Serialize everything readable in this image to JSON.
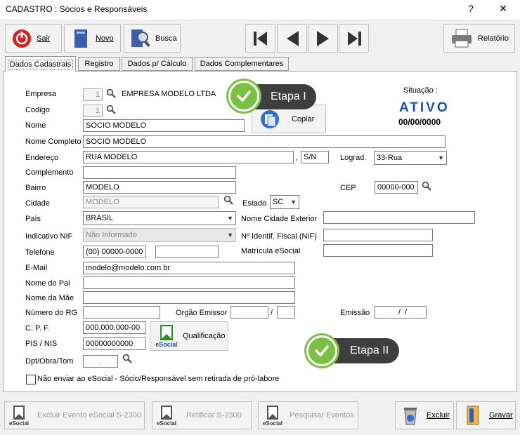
{
  "window": {
    "title": "CADASTRO : Sócios e Responsáveis",
    "help": "?",
    "close": "✕"
  },
  "toolbar": {
    "exit": "Sair",
    "new": "Novo",
    "search": "Busca",
    "report": "Relatório"
  },
  "tabs": [
    "Dados Cadastrais",
    "Registro",
    "Dados p/ Cálculo",
    "Dados Complementares"
  ],
  "form": {
    "empresa_label": "Empresa",
    "empresa_code": "1",
    "empresa_name": "EMPRESA MODELO LTDA",
    "codigo_label": "Codigo",
    "codigo_value": "1",
    "nome_label": "Nome",
    "nome_value": "SOCIO MODELO",
    "copiar": "Copiar",
    "nome_completo_label": "Nome Completo",
    "nome_completo_value": "SOCIO MODELO",
    "endereco_label": "Endereço",
    "endereco_value": "RUA MODELO",
    "numero_sep": ",",
    "numero_value": "S/N",
    "lograd_label": "Lograd.",
    "lograd_value": "33-Rua",
    "complemento_label": "Complemento",
    "complemento_value": "",
    "bairro_label": "Bairro",
    "bairro_value": "MODELO",
    "cep_label": "CEP",
    "cep_value": "00000-000",
    "cidade_label": "Cidade",
    "cidade_value": "MODELO",
    "estado_label": "Estado",
    "estado_value": "SC",
    "pais_label": "País",
    "pais_value": "BRASIL",
    "nome_cidade_ext_label": "Nome Cidade Exterior",
    "nif_label": "Indicativo NIF",
    "nif_value": "Não Informado",
    "nif_num_label": "Nº Identif. Fiscal (NIF)",
    "telefone_label": "Telefone",
    "telefone_value": "(00) 00000-0000",
    "matricula_label": "Matrícula eSocial",
    "email_label": "E-Mail",
    "email_value": "modelo@modelo.com.br",
    "pai_label": "Nome do Pai",
    "mae_label": "Nome da Mãe",
    "rg_label": "Número do RG",
    "orgao_label": "Orgão Emissor",
    "orgao_sep": "/",
    "emissao_label": "Emissão",
    "emissao_value": "  /  /",
    "cpf_label": "C. P. F.",
    "cpf_value": "000.000.000-00",
    "pis_label": "PIS / NIS",
    "pis_value": "00000000000",
    "qualificacao": "Qualificação",
    "dpt_label": "Dpt/Obra/Tom",
    "dpt_value": ".",
    "checkbox_label": "Não enviar ao eSocial - Sócio/Responsável sem retirada de pró-labore"
  },
  "status": {
    "label": "Situação :",
    "value": "ATIVO",
    "date": "00/00/0000"
  },
  "callouts": {
    "step1": "Etapa I",
    "step2": "Etapa II"
  },
  "bottom": {
    "excluir_evento": "Excluir Evento eSocial S-2300",
    "retificar": "Retificar S-2300",
    "pesquisar": "Pesquisar Eventos",
    "excluir": "Excluir",
    "gravar": "Gravar",
    "esocial": "eSocial"
  },
  "colors": {
    "accent_blue": "#1a4fb3",
    "badge": "#3e3e3e",
    "check_green": "#7ac043"
  }
}
